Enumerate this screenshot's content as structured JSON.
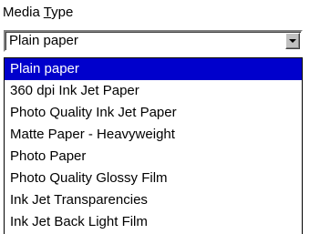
{
  "label": {
    "prefix": "Media ",
    "mnemonic": "T",
    "rest": "ype"
  },
  "combo": {
    "value": "Plain paper",
    "arrow_icon": "chevron-down-icon"
  },
  "options": [
    "Plain paper",
    "360 dpi Ink Jet Paper",
    "Photo Quality Ink Jet Paper",
    "Matte Paper - Heavyweight",
    "Photo Paper",
    "Photo Quality Glossy Film",
    "Ink Jet Transparencies",
    "Ink Jet Back Light Film"
  ],
  "selected_index": 0,
  "colors": {
    "highlight": "#0000cc",
    "highlight_text": "#ffffff"
  }
}
